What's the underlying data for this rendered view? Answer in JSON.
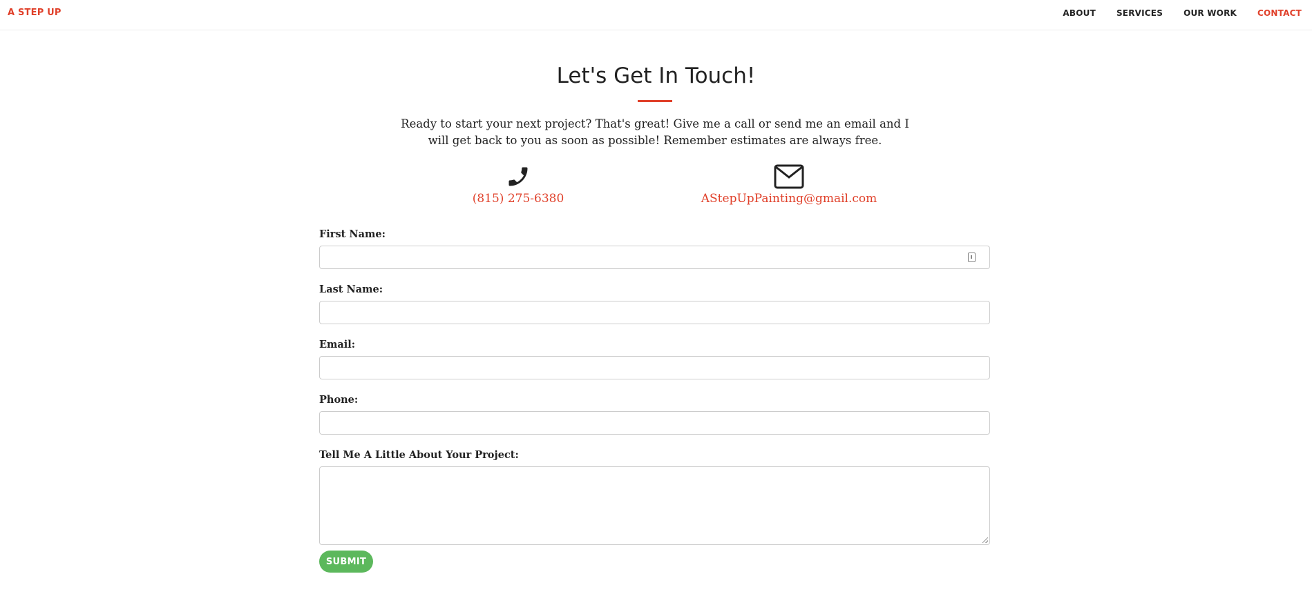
{
  "navbar": {
    "brand": "A STEP UP",
    "links": [
      {
        "label": "ABOUT"
      },
      {
        "label": "SERVICES"
      },
      {
        "label": "OUR WORK"
      },
      {
        "label": "CONTACT"
      }
    ],
    "active_link": "CONTACT"
  },
  "contact": {
    "title": "Let's Get In Touch!",
    "intro": "Ready to start your next project? That's great! Give me a call or send me an email and I will get back to you as soon as possible! Remember estimates are always free.",
    "phone": {
      "icon": "phone-icon",
      "value": "(815) 275-6380"
    },
    "email": {
      "icon": "envelope-icon",
      "value": "AStepUpPainting@gmail.com"
    }
  },
  "form": {
    "first_name": {
      "label": "First Name:",
      "value": ""
    },
    "last_name": {
      "label": "Last Name:",
      "value": ""
    },
    "email": {
      "label": "Email:",
      "value": ""
    },
    "phone": {
      "label": "Phone:",
      "value": ""
    },
    "project": {
      "label": "Tell Me A Little About Your Project:",
      "value": ""
    },
    "submit_label": "SUBMIT"
  },
  "colors": {
    "accent": "#e0402a",
    "submit": "#5cb85c",
    "text": "#222222"
  }
}
